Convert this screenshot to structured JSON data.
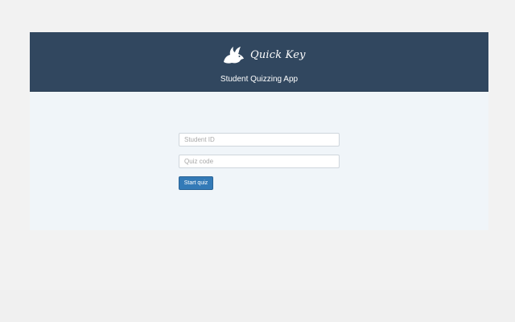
{
  "header": {
    "logo_text": "Quick Key",
    "logo_icon": "rabbit-icon",
    "subtitle": "Student Quizzing App",
    "background_color": "#31475f"
  },
  "form": {
    "student_id": {
      "value": "",
      "placeholder": "Student ID"
    },
    "quiz_code": {
      "value": "",
      "placeholder": "Quiz code"
    },
    "start_button_label": "Start quiz",
    "button_color": "#337ab7"
  }
}
